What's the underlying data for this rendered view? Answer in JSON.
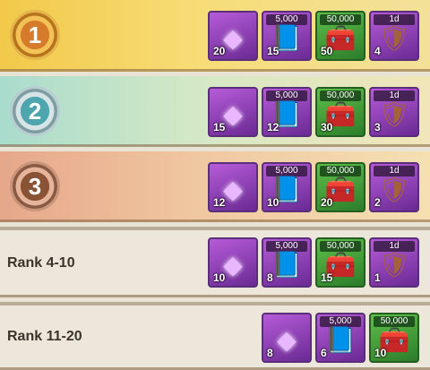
{
  "rows": [
    {
      "type": "medal",
      "medal_label": "1",
      "medal_style": "gold",
      "rewards": [
        {
          "icon": "purple-gem-icon",
          "tag": "",
          "quantity": "20"
        },
        {
          "icon": "purple-book-icon",
          "tag": "5,000",
          "quantity": "15"
        },
        {
          "icon": "treasure-chest-icon",
          "tag": "50,000",
          "quantity": "50"
        },
        {
          "icon": "shield-icon",
          "tag": "1d",
          "quantity": "4"
        }
      ]
    },
    {
      "type": "medal",
      "medal_label": "2",
      "medal_style": "silver",
      "rewards": [
        {
          "icon": "purple-gem-icon",
          "tag": "",
          "quantity": "15"
        },
        {
          "icon": "purple-book-icon",
          "tag": "5,000",
          "quantity": "12"
        },
        {
          "icon": "treasure-chest-icon",
          "tag": "50,000",
          "quantity": "30"
        },
        {
          "icon": "shield-icon",
          "tag": "1d",
          "quantity": "3"
        }
      ]
    },
    {
      "type": "medal",
      "medal_label": "3",
      "medal_style": "bronze",
      "rewards": [
        {
          "icon": "purple-gem-icon",
          "tag": "",
          "quantity": "12"
        },
        {
          "icon": "purple-book-icon",
          "tag": "5,000",
          "quantity": "10"
        },
        {
          "icon": "treasure-chest-icon",
          "tag": "50,000",
          "quantity": "20"
        },
        {
          "icon": "shield-icon",
          "tag": "1d",
          "quantity": "2"
        }
      ]
    },
    {
      "type": "label",
      "label": "Rank 4-10",
      "rewards": [
        {
          "icon": "purple-gem-icon",
          "tag": "",
          "quantity": "10"
        },
        {
          "icon": "purple-book-icon",
          "tag": "5,000",
          "quantity": "8"
        },
        {
          "icon": "treasure-chest-icon",
          "tag": "50,000",
          "quantity": "15"
        },
        {
          "icon": "shield-icon",
          "tag": "1d",
          "quantity": "1"
        }
      ]
    },
    {
      "type": "label",
      "label": "Rank 11-20",
      "rewards": [
        {
          "icon": "purple-gem-icon",
          "tag": "",
          "quantity": "8"
        },
        {
          "icon": "purple-book-icon",
          "tag": "5,000",
          "quantity": "6"
        },
        {
          "icon": "treasure-chest-icon",
          "tag": "50,000",
          "quantity": "10"
        }
      ]
    }
  ]
}
